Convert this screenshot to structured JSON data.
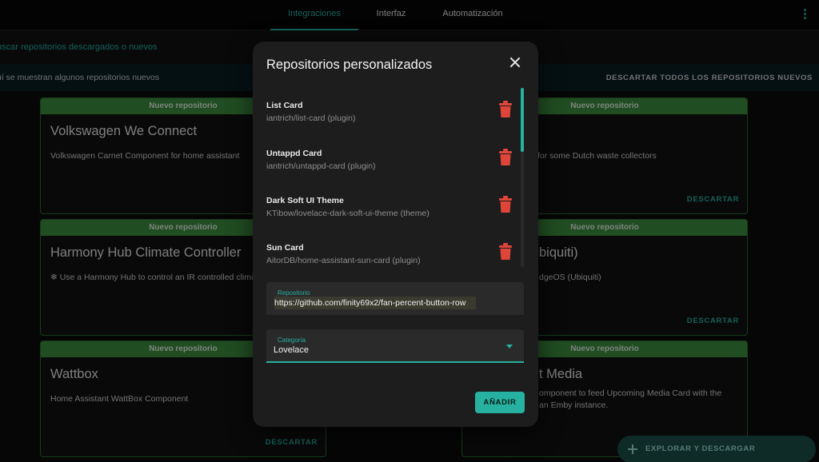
{
  "nav": {
    "tabs": [
      {
        "label": "Integraciones"
      },
      {
        "label": "Interfaz"
      },
      {
        "label": "Automatización"
      }
    ]
  },
  "search": {
    "placeholder": "uscar repositorios descargados o nuevos"
  },
  "info": {
    "text": "uí se muestran algunos repositorios nuevos",
    "dismiss_all": "DESCARTAR TODOS LOS REPOSITORIOS NUEVOS"
  },
  "cards": [
    {
      "badge": "Nuevo repositorio",
      "title": "Volkswagen We Connect",
      "desc": "Volkswagen Carnet Component for home assistant",
      "dismiss": ""
    },
    {
      "badge": "Nuevo repositorio",
      "title": "",
      "desc": "for some Dutch waste collectors",
      "dismiss": "DESCARTAR"
    },
    {
      "badge": "Nuevo repositorio",
      "title": "Harmony Hub Climate Controller",
      "desc": "❄ Use a Harmony Hub to control an IR controlled clima",
      "dismiss": ""
    },
    {
      "badge": "Nuevo repositorio",
      "title": "biquiti)",
      "desc": "dgeOS (Ubiquiti)",
      "dismiss": "DESCARTAR"
    },
    {
      "badge": "Nuevo repositorio",
      "title": "Wattbox",
      "desc": "Home Assistant WattBox Component",
      "dismiss": "DESCARTAR"
    },
    {
      "badge": "Nuevo repositorio",
      "title": "t Media",
      "desc": "omponent to feed Upcoming Media Card with the\nan Emby instance.",
      "dismiss": ""
    }
  ],
  "dialog": {
    "title": "Repositorios personalizados",
    "repos": [
      {
        "name": "List Card",
        "sub": "iantrich/list-card (plugin)"
      },
      {
        "name": "Untappd Card",
        "sub": "iantrich/untappd-card (plugin)"
      },
      {
        "name": "Dark Soft UI Theme",
        "sub": "KTibow/lovelace-dark-soft-ui-theme (theme)"
      },
      {
        "name": "Sun Card",
        "sub": "AitorDB/home-assistant-sun-card (plugin)"
      }
    ],
    "repo_field": {
      "label": "Repositorio",
      "value": "https://github.com/finity69x2/fan-percent-button-row"
    },
    "category_field": {
      "label": "Categoría",
      "value": "Lovelace"
    },
    "add_label": "AÑADIR"
  },
  "fab": {
    "label": "EXPLORAR Y DESCARGAR REPOSITORIOS"
  },
  "colors": {
    "accent": "#26b1a0",
    "card_header": "#3c8c3e",
    "delete": "#e0453a"
  }
}
